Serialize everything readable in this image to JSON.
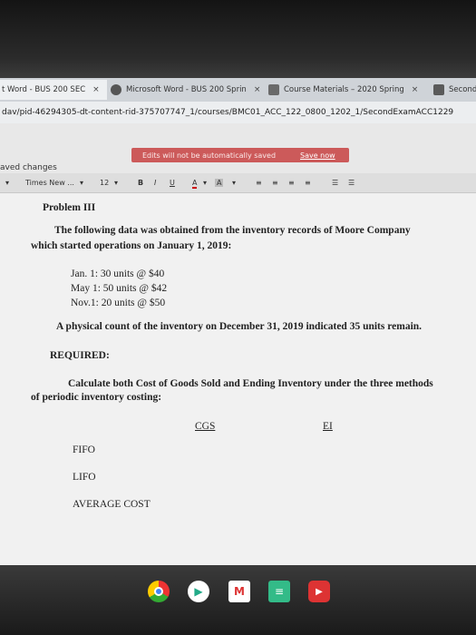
{
  "browser": {
    "tabs": [
      {
        "label": "t Word - BUS 200 SEC",
        "close": "×"
      },
      {
        "label": "Microsoft Word - BUS 200 Sprin",
        "close": "×"
      },
      {
        "label": "Course Materials – 2020 Spring",
        "close": "×"
      },
      {
        "label": "Second",
        "close": ""
      }
    ],
    "url": "dav/pid-46294305-dt-content-rid-375707747_1/courses/BMC01_ACC_122_0800_1202_1/SecondExamACC1229"
  },
  "app": {
    "saved_status": "aved changes",
    "notice_text": "Edits will not be automatically saved",
    "save_now": "Save now"
  },
  "toolbar": {
    "font_name": "Times New ...",
    "font_size": "12",
    "bold": "B",
    "italic": "I",
    "underline": "U",
    "font_color": "A",
    "highlight": "A"
  },
  "document": {
    "heading": "Problem III",
    "intro_line1": "The following data was obtained from the inventory records of Moore Company",
    "intro_line2": "which started operations on January 1, 2019:",
    "purchases": [
      "Jan. 1: 30 units @ $40",
      "May 1: 50 units @ $42",
      "Nov.1: 20 units @ $50"
    ],
    "physical_count": "A physical count of the inventory on December 31, 2019 indicated 35 units remain.",
    "required": "REQUIRED:",
    "instruction_line1": "Calculate both Cost of Goods Sold and Ending Inventory under the three methods",
    "instruction_line2": "of periodic inventory costing:",
    "col_cgs": "CGS",
    "col_ei": "EI",
    "methods": [
      "FIFO",
      "LIFO",
      "AVERAGE COST"
    ]
  },
  "colors": {
    "notice_bg": "#cc5a5a",
    "doc_bg": "#f1f1f1",
    "taskbar": "#1a1a1a"
  },
  "taskbar": {
    "icons": [
      "chrome-icon",
      "play-store-icon",
      "gmail-icon",
      "docs-icon",
      "youtube-icon"
    ]
  }
}
